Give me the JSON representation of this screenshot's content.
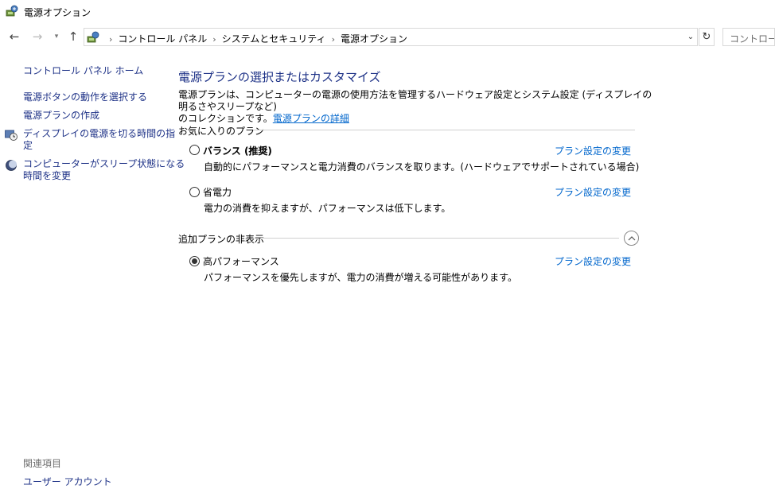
{
  "window": {
    "title": "電源オプション"
  },
  "nav": {
    "breadcrumbs": [
      "コントロール パネル",
      "システムとセキュリティ",
      "電源オプション"
    ],
    "search_placeholder": "コントロール"
  },
  "sidebar": {
    "home": "コントロール パネル ホーム",
    "links": [
      {
        "label": "電源ボタンの動作を選択する",
        "icon": null
      },
      {
        "label": "電源プランの作成",
        "icon": null
      },
      {
        "label_line1": "ディスプレイの電源を切る時間の指",
        "label_line2": "定",
        "icon": "display-timer-icon"
      },
      {
        "label_line1": "コンピューターがスリープ状態になる",
        "label_line2": "時間を変更",
        "icon": "sleep-moon-icon"
      }
    ],
    "related": {
      "title": "関連項目",
      "links": [
        "ユーザー アカウント"
      ]
    }
  },
  "main": {
    "title": "電源プランの選択またはカスタマイズ",
    "description_line1": "電源プランは、コンピューターの電源の使用方法を管理するハードウェア設定とシステム設定 (ディスプレイの明るさやスリープなど)",
    "description_line2_prefix": "のコレクションです。",
    "description_link": "電源プランの詳細",
    "favorites_title": "お気に入りのプラン",
    "additional_title": "追加プランの非表示",
    "change_link": "プラン設定の変更",
    "plans": [
      {
        "name": "バランス (推奨)",
        "description": "自動的にパフォーマンスと電力消費のバランスを取ります。(ハードウェアでサポートされている場合)",
        "selected": false
      },
      {
        "name": "省電力",
        "description": "電力の消費を抑えますが、パフォーマンスは低下します。",
        "selected": false
      },
      {
        "name": "高パフォーマンス",
        "description": "パフォーマンスを優先しますが、電力の消費が増える可能性があります。",
        "selected": true
      }
    ]
  },
  "colors": {
    "link": "#1e3287",
    "hyperlink": "#0066cc",
    "divider": "#d0d0d0"
  }
}
